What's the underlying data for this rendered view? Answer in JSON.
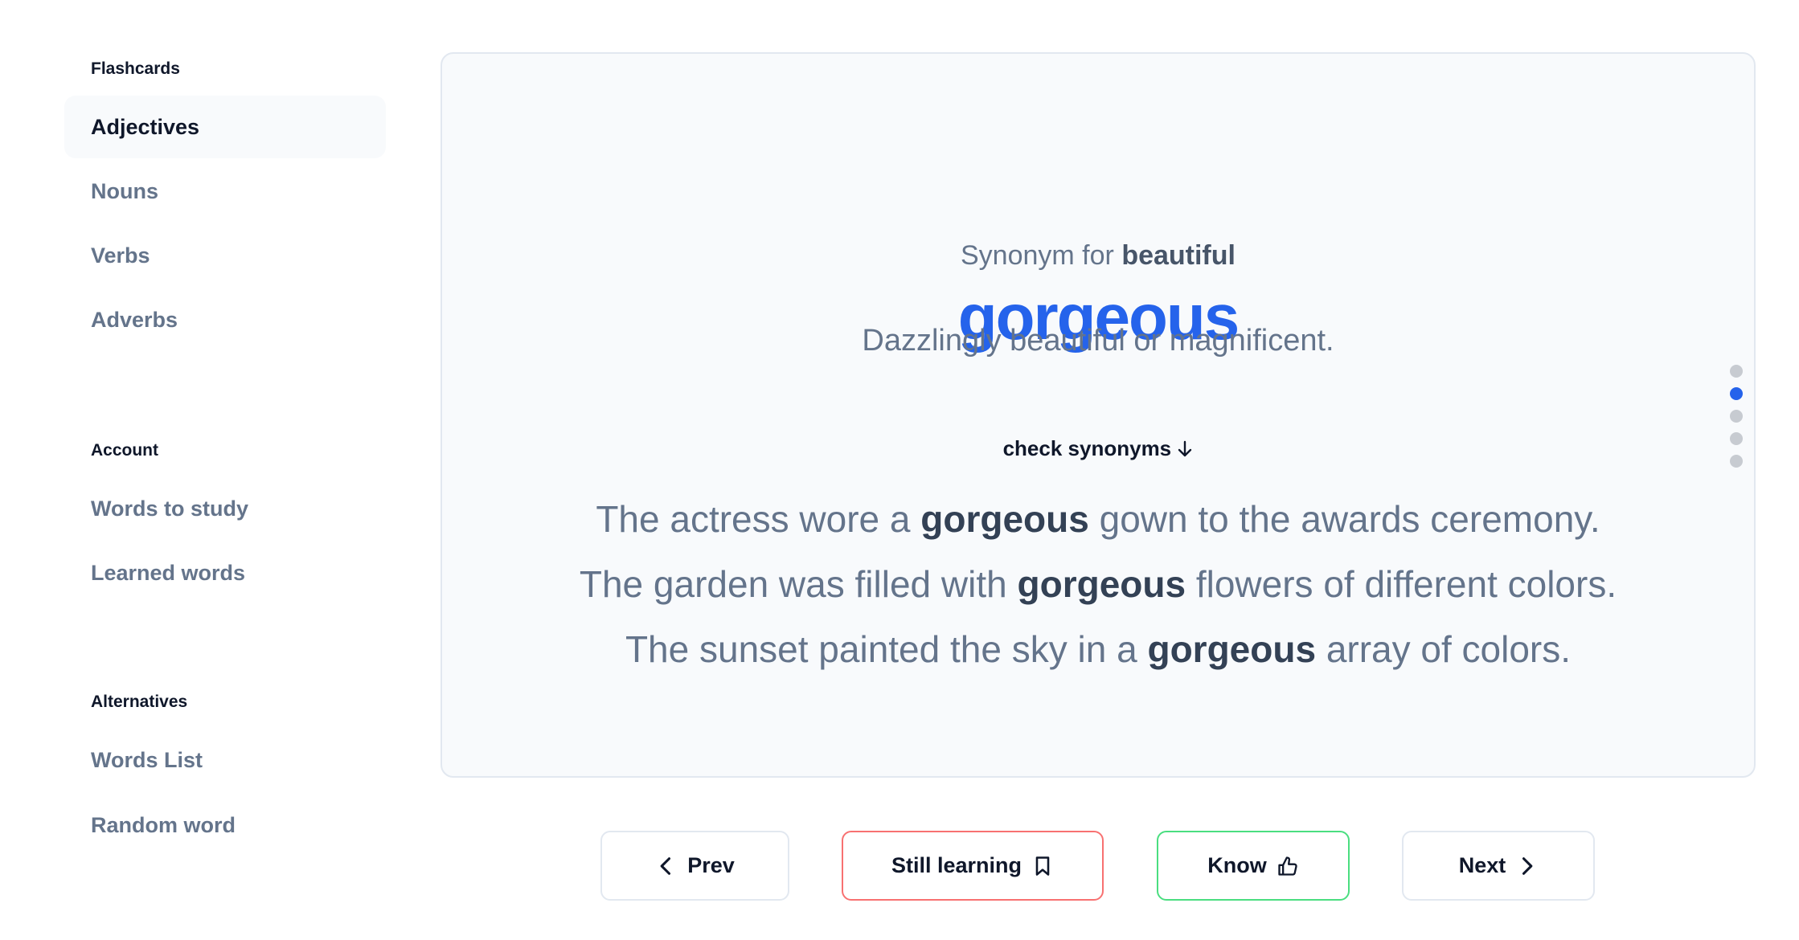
{
  "sidebar": {
    "sections": [
      {
        "title": "Flashcards",
        "items": [
          "Adjectives",
          "Nouns",
          "Verbs",
          "Adverbs"
        ],
        "active": "Adjectives"
      },
      {
        "title": "Account",
        "items": [
          "Words to study",
          "Learned words"
        ]
      },
      {
        "title": "Alternatives",
        "items": [
          "Words List",
          "Random word"
        ]
      }
    ]
  },
  "card": {
    "prompt_prefix": "Synonym for",
    "prompt_word": "beautiful",
    "word": "gorgeous",
    "definition": "Dazzlingly beautiful or magnificent.",
    "check_label": "check synonyms",
    "sentences": [
      {
        "before": "The actress wore a",
        "word": "gorgeous",
        "after": "gown to the awards ceremony."
      },
      {
        "before": "The garden was filled with",
        "word": "gorgeous",
        "after": "flowers of different colors."
      },
      {
        "before": "The sunset painted the sky in a",
        "word": "gorgeous",
        "after": "array of colors."
      }
    ],
    "pagination": {
      "total": 5,
      "current": 2
    }
  },
  "actions": {
    "prev": "Prev",
    "still_learning": "Still learning",
    "know": "Know",
    "next": "Next"
  },
  "colors": {
    "accent": "#2563eb",
    "still_learning_border": "#f87171",
    "know_border": "#4ade80"
  }
}
